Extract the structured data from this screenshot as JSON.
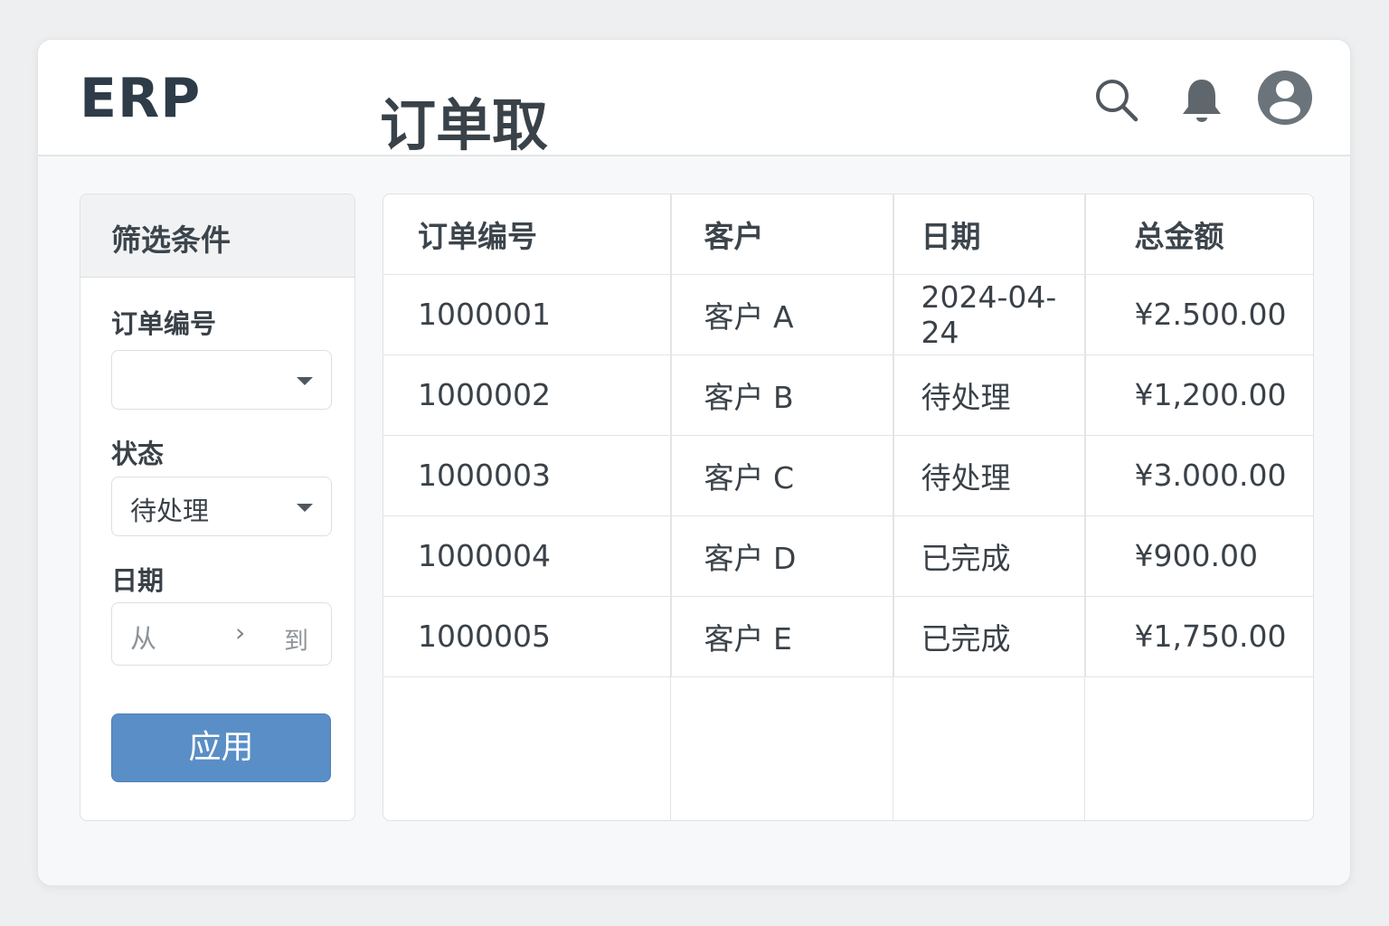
{
  "header": {
    "logo": "ERP",
    "title": "订单取",
    "icons": [
      "search-icon",
      "bell-icon",
      "user-avatar-icon"
    ]
  },
  "filters": {
    "title": "筛选条件",
    "order_no_label": "订单编号",
    "order_no_value": "",
    "status_label": "状态",
    "status_value": "待处理",
    "date_label": "日期",
    "date_from": "从",
    "date_to": "到",
    "apply": "应用"
  },
  "table": {
    "headers": [
      "订单编号",
      "客户",
      "日期",
      "总金额"
    ],
    "rows": [
      [
        "1000001",
        "客户 A",
        "2024-04-24",
        "¥2.500.00"
      ],
      [
        "1000002",
        "客户 B",
        "待处理",
        "¥1,200.00"
      ],
      [
        "1000003",
        "客户 C",
        "待处理",
        "¥3.000.00"
      ],
      [
        "1000004",
        "客户 D",
        "已完成",
        "¥900.00"
      ],
      [
        "1000005",
        "客户 E",
        "已完成",
        "¥1,750.00"
      ]
    ]
  },
  "colors": {
    "accent": "#5a8ec6",
    "icon": "#5f676d"
  }
}
